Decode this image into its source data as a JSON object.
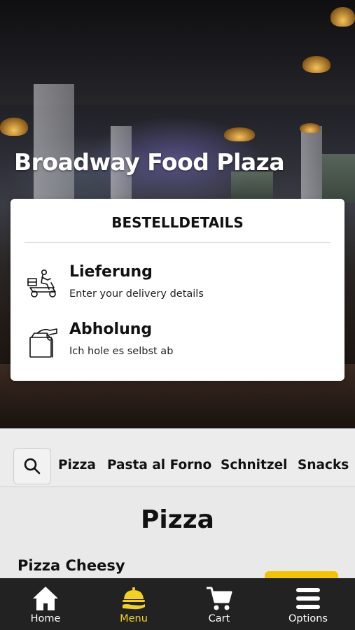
{
  "restaurant": {
    "name": "Broadway Food Plaza"
  },
  "order_details": {
    "title": "BESTELLDETAILS",
    "options": [
      {
        "icon": "delivery-scooter-icon",
        "title": "Lieferung",
        "subtitle": "Enter your delivery details"
      },
      {
        "icon": "takeaway-bag-icon",
        "title": "Abholung",
        "subtitle": "Ich hole es selbst ab"
      }
    ]
  },
  "categories": [
    "Pizza",
    "Pasta al Forno",
    "Schnitzel",
    "Snacks"
  ],
  "menu": {
    "section_title": "Pizza",
    "first_product": "Pizza Cheesy"
  },
  "bottom_nav": [
    {
      "label": "Home",
      "icon": "home-icon",
      "active": false
    },
    {
      "label": "Menu",
      "icon": "menu-cloche-icon",
      "active": true
    },
    {
      "label": "Cart",
      "icon": "cart-icon",
      "active": false
    },
    {
      "label": "Options",
      "icon": "hamburger-icon",
      "active": false
    }
  ],
  "colors": {
    "accent": "#f2d21c",
    "nav_bg": "#222222",
    "button": "#f2c400"
  }
}
